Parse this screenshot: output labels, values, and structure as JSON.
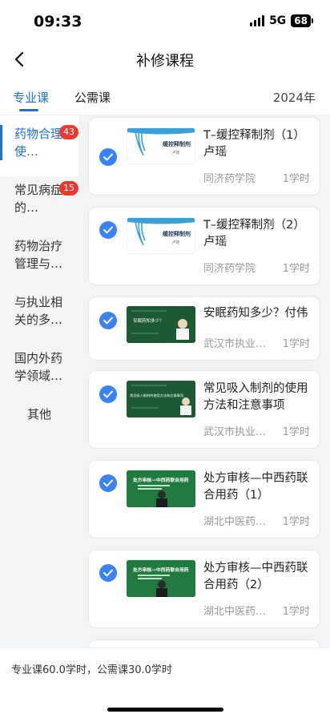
{
  "status": {
    "time": "09:33",
    "network": "5G",
    "battery": "68"
  },
  "nav": {
    "title": "补修课程"
  },
  "tabs": [
    {
      "label": "专业课"
    },
    {
      "label": "公需课"
    }
  ],
  "year": "2024年",
  "sidebar": {
    "items": [
      {
        "label": "药物合理使…",
        "badge": "43"
      },
      {
        "label": "常见病症的…",
        "badge": "15"
      },
      {
        "label": "药物治疗管理与…"
      },
      {
        "label": "与执业相关的多…"
      },
      {
        "label": "国内外药学领域…"
      },
      {
        "label": "其他"
      }
    ]
  },
  "courses": [
    {
      "title": "T–缓控释制剂（1）卢瑶",
      "org": "同济药学院",
      "hours": "1学时",
      "thumb_text": "缓控释制剂",
      "thumb_sub": "卢瑶"
    },
    {
      "title": "T–缓控释制剂（2）卢瑶",
      "org": "同济药学院",
      "hours": "1学时",
      "thumb_text": "缓控释制剂",
      "thumb_sub": "卢瑶"
    },
    {
      "title": "安眠药知多少？付伟",
      "org": "武汉市执业…",
      "hours": "1学时",
      "thumb_text": "安眠药知多少？",
      "thumb_sub": ""
    },
    {
      "title": "常见吸入制剂的使用方法和注意事项",
      "org": "武汉市执业…",
      "hours": "1学时",
      "thumb_text": "常见吸入制剂的使用方法和注意事项",
      "thumb_sub": ""
    },
    {
      "title": "处方审核—中西药联合用药（1）",
      "org": "湖北中医药…",
      "hours": "1学时",
      "thumb_text": "处方审核—中西药联合用药",
      "thumb_sub": ""
    },
    {
      "title": "处方审核—中西药联合用药（2）",
      "org": "湖北中医药…",
      "hours": "1学时",
      "thumb_text": "处方审核—中西药联合用药",
      "thumb_sub": ""
    }
  ],
  "footer": {
    "summary": "专业课60.0学时，公需课30.0学时"
  },
  "colors": {
    "accent": "#1e6fd9",
    "badge": "#e8392f",
    "check": "#3b82f6"
  }
}
